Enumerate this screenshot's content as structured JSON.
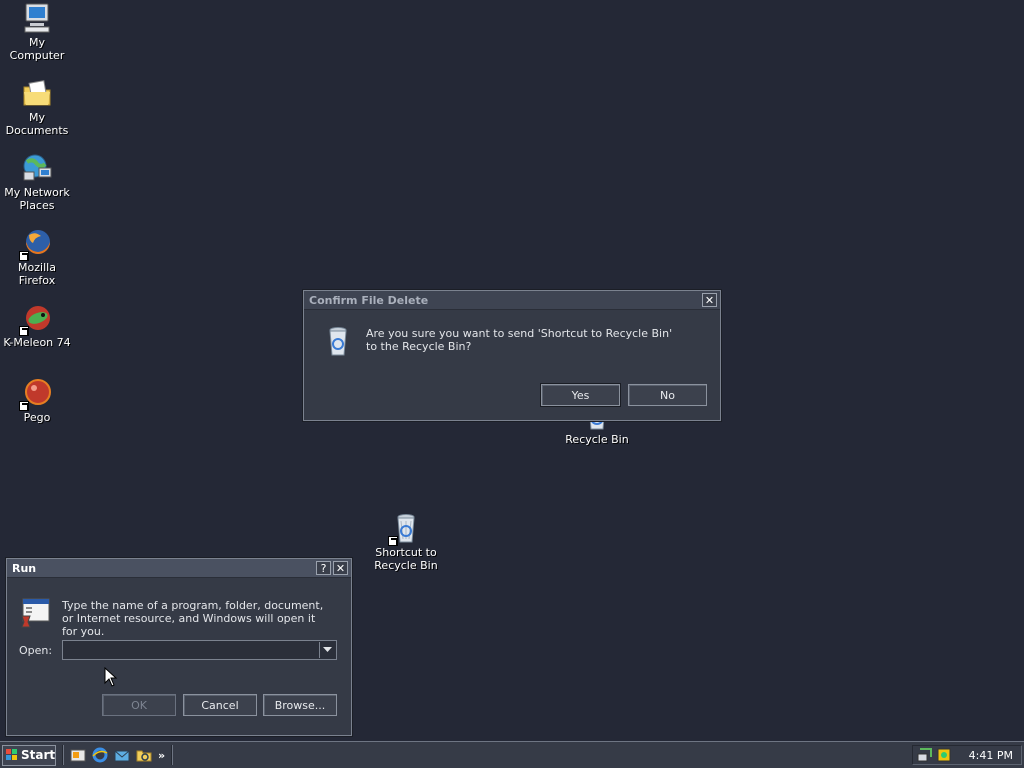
{
  "desktop_icons": [
    {
      "label": "My Computer",
      "icon": "my-computer-icon"
    },
    {
      "label": "My Documents",
      "icon": "my-documents-icon"
    },
    {
      "label": "My Network Places",
      "icon": "network-places-icon"
    },
    {
      "label": "Mozilla Firefox",
      "icon": "firefox-icon",
      "shortcut": true
    },
    {
      "label": "K-Meleon 74",
      "icon": "kmeleon-icon",
      "shortcut": true
    },
    {
      "label": "Pego",
      "icon": "pego-icon",
      "shortcut": true
    },
    {
      "label": "Recycle Bin",
      "icon": "recycle-bin-icon"
    },
    {
      "label": "Shortcut to Recycle Bin",
      "icon": "recycle-bin-shortcut-icon",
      "shortcut": true
    }
  ],
  "confirm_dialog": {
    "title": "Confirm File Delete",
    "message": "Are you sure you want to send 'Shortcut to Recycle Bin' to the Recycle Bin?",
    "yes_label": "Yes",
    "no_label": "No",
    "close_glyph": "✕"
  },
  "run_dialog": {
    "title": "Run",
    "help_glyph": "?",
    "close_glyph": "✕",
    "description": "Type the name of a program, folder, document, or Internet resource, and Windows will open it for you.",
    "open_label": "Open:",
    "open_value": "",
    "ok_label": "OK",
    "cancel_label": "Cancel",
    "browse_label": "Browse..."
  },
  "taskbar": {
    "start_label": "Start",
    "overflow_glyph": "»",
    "clock": "4:41 PM"
  },
  "colors": {
    "desktop": "#242836",
    "dialog": "#353a46",
    "titlebar_active": "#4a5161"
  }
}
